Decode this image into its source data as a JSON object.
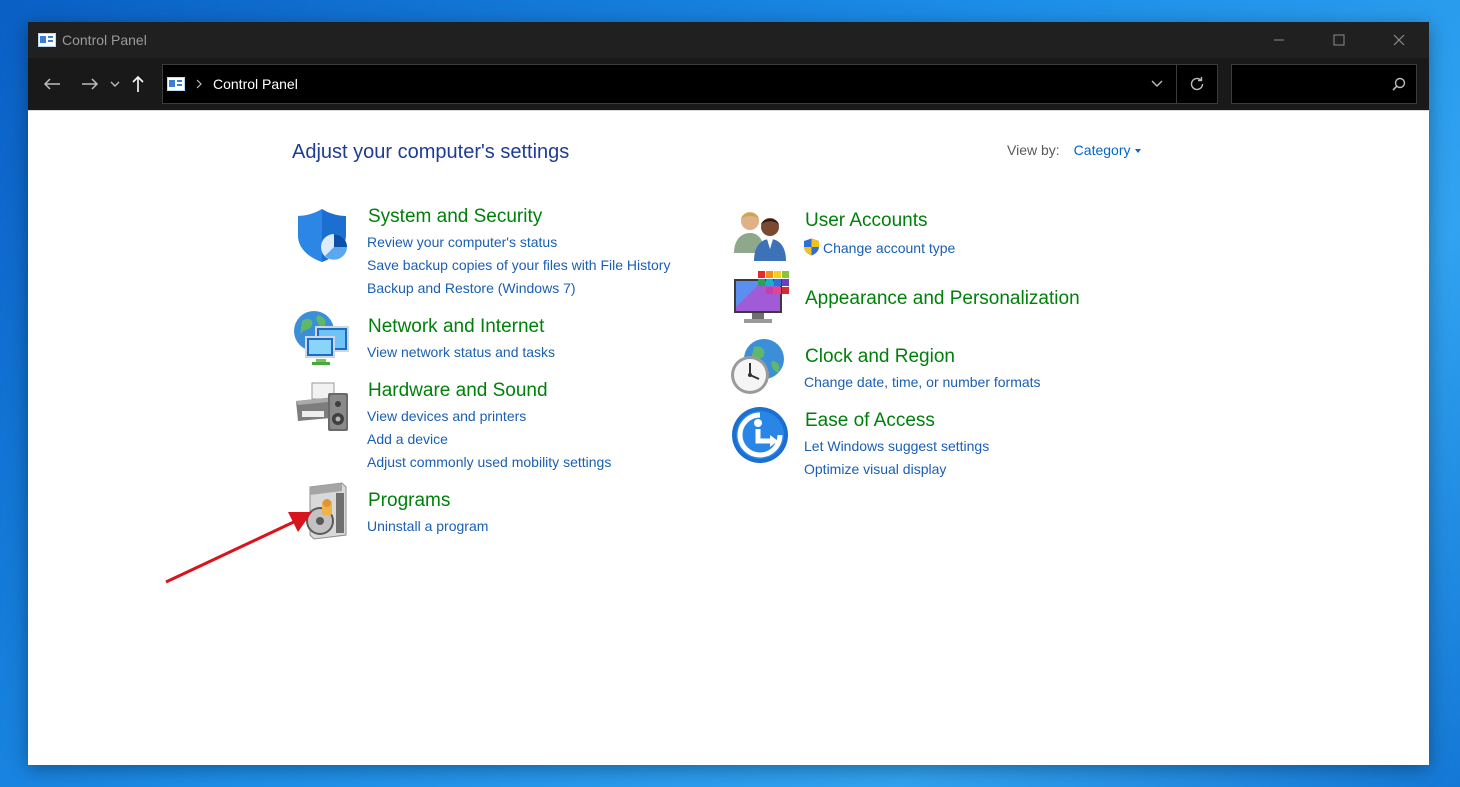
{
  "window": {
    "title": "Control Panel"
  },
  "navbar": {
    "address": "Control Panel"
  },
  "main": {
    "heading": "Adjust your computer's settings",
    "view_by_label": "View by:",
    "view_by_value": "Category"
  },
  "categories": {
    "system_security": {
      "title": "System and Security",
      "icon": "shield-icon",
      "links": [
        "Review your computer's status",
        "Save backup copies of your files with File History",
        "Backup and Restore (Windows 7)"
      ]
    },
    "network": {
      "title": "Network and Internet",
      "icon": "network-globe-icon",
      "links": [
        "View network status and tasks"
      ]
    },
    "hardware": {
      "title": "Hardware and Sound",
      "icon": "printer-speaker-icon",
      "links": [
        "View devices and printers",
        "Add a device",
        "Adjust commonly used mobility settings"
      ]
    },
    "programs": {
      "title": "Programs",
      "icon": "programs-disc-icon",
      "links": [
        "Uninstall a program"
      ]
    },
    "user_accounts": {
      "title": "User Accounts",
      "icon": "users-icon",
      "links": [
        "Change account type"
      ]
    },
    "appearance": {
      "title": "Appearance and Personalization",
      "icon": "monitor-palette-icon",
      "links": []
    },
    "clock": {
      "title": "Clock and Region",
      "icon": "clock-globe-icon",
      "links": [
        "Change date, time, or number formats"
      ]
    },
    "ease": {
      "title": "Ease of Access",
      "icon": "ease-of-access-icon",
      "links": [
        "Let Windows suggest settings",
        "Optimize visual display"
      ]
    }
  },
  "colors": {
    "heading": "#1e3c96",
    "category_title": "#00800a",
    "link": "#1a5fb4",
    "annotation_arrow": "#d8141c"
  }
}
